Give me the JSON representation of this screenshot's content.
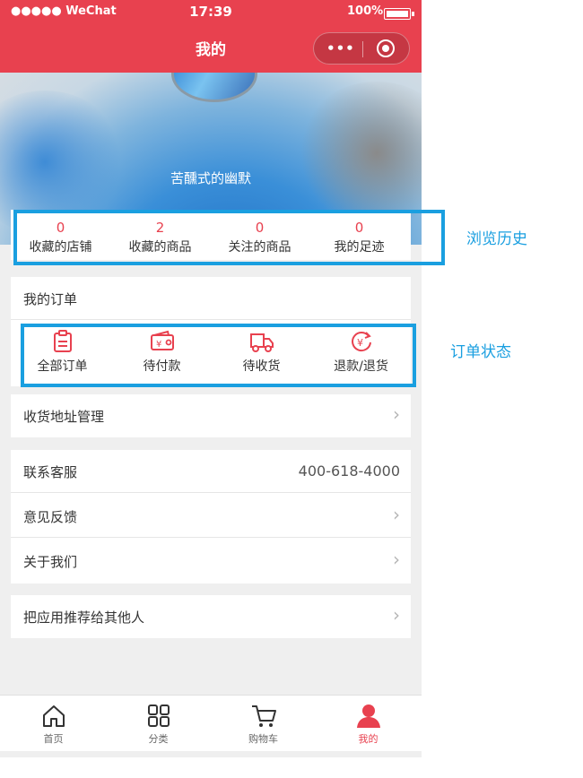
{
  "status_bar": {
    "carrier": "●●●●● WeChat",
    "time": "17:39",
    "battery": "100%"
  },
  "navbar": {
    "title": "我的",
    "menu_label": "•••"
  },
  "profile": {
    "nickname": "苦醺式的幽默"
  },
  "stats": [
    {
      "count": "0",
      "label": "收藏的店铺"
    },
    {
      "count": "2",
      "label": "收藏的商品"
    },
    {
      "count": "0",
      "label": "关注的商品"
    },
    {
      "count": "0",
      "label": "我的足迹"
    }
  ],
  "orders": {
    "header": "我的订单",
    "items": [
      {
        "label": "全部订单",
        "icon": "clipboard-icon"
      },
      {
        "label": "待付款",
        "icon": "wallet-icon"
      },
      {
        "label": "待收货",
        "icon": "delivery-truck-icon"
      },
      {
        "label": "退款/退货",
        "icon": "refund-icon"
      }
    ]
  },
  "menu": {
    "address": "收货地址管理",
    "service": "联系客服",
    "service_phone": "400-618-4000",
    "feedback": "意见反馈",
    "about": "关于我们",
    "recommend": "把应用推荐给其他人"
  },
  "annotations": {
    "history": "浏览历史",
    "order_status": "订单状态"
  },
  "tabbar": [
    {
      "label": "首页",
      "icon": "home-icon"
    },
    {
      "label": "分类",
      "icon": "category-grid-icon"
    },
    {
      "label": "购物车",
      "icon": "cart-icon"
    },
    {
      "label": "我的",
      "icon": "user-icon",
      "active": true
    }
  ],
  "colors": {
    "brand": "#e8414f",
    "annotation": "#1a9fe0"
  }
}
